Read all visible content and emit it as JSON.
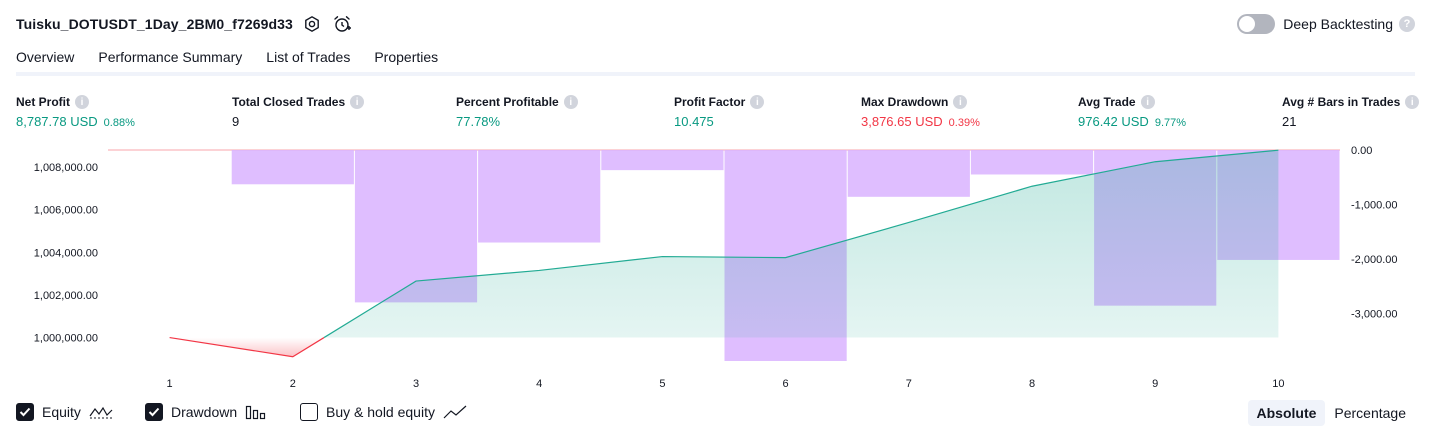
{
  "header": {
    "title": "Tuisku_DOTUSDT_1Day_2BM0_f7269d33",
    "deep_backtesting_label": "Deep Backtesting"
  },
  "tabs": [
    {
      "label": "Overview",
      "active": true
    },
    {
      "label": "Performance Summary",
      "active": false
    },
    {
      "label": "List of Trades",
      "active": false
    },
    {
      "label": "Properties",
      "active": false
    }
  ],
  "metrics": [
    {
      "label": "Net Profit",
      "value": "8,787.78 USD",
      "sub": "0.88%",
      "tone": "pos"
    },
    {
      "label": "Total Closed Trades",
      "value": "9",
      "sub": "",
      "tone": "plain"
    },
    {
      "label": "Percent Profitable",
      "value": "77.78%",
      "sub": "",
      "tone": "pos"
    },
    {
      "label": "Profit Factor",
      "value": "10.475",
      "sub": "",
      "tone": "pos"
    },
    {
      "label": "Max Drawdown",
      "value": "3,876.65 USD",
      "sub": "0.39%",
      "tone": "neg"
    },
    {
      "label": "Avg Trade",
      "value": "976.42 USD",
      "sub": "9.77%",
      "tone": "pos"
    },
    {
      "label": "Avg # Bars in Trades",
      "value": "21",
      "sub": "",
      "tone": "plain"
    }
  ],
  "legend": {
    "equity_label": "Equity",
    "equity_checked": true,
    "drawdown_label": "Drawdown",
    "drawdown_checked": true,
    "buyhold_label": "Buy & hold equity",
    "buyhold_checked": false
  },
  "modes": {
    "absolute_label": "Absolute",
    "percentage_label": "Percentage",
    "active": "absolute"
  },
  "colors": {
    "equity_up": "#22ab94",
    "equity_down": "#f23645",
    "drawdown": "#d9b3ff",
    "text": "#131722"
  },
  "chart_data": {
    "type": "area",
    "x": [
      1,
      2,
      3,
      4,
      5,
      6,
      7,
      8,
      9,
      10
    ],
    "series": [
      {
        "name": "Equity",
        "axis": "left",
        "values": [
          1000000,
          999100,
          1002650,
          1003150,
          1003800,
          1003750,
          1005400,
          1007100,
          1008250,
          1008790
        ]
      },
      {
        "name": "Drawdown",
        "axis": "right",
        "values": [
          0,
          -630,
          -2800,
          -1700,
          -370,
          -3877,
          -860,
          -450,
          -2860,
          -2020
        ]
      }
    ],
    "left_axis_ticks": [
      "1,000,000.00",
      "1,002,000.00",
      "1,004,000.00",
      "1,006,000.00",
      "1,008,000.00"
    ],
    "right_axis_ticks": [
      "0.00",
      "-1,000.00",
      "-2,000.00",
      "-3,000.00"
    ],
    "left_ylim": [
      998900,
      1008800
    ],
    "right_ylim": [
      -3877,
      0
    ],
    "grid": false
  }
}
